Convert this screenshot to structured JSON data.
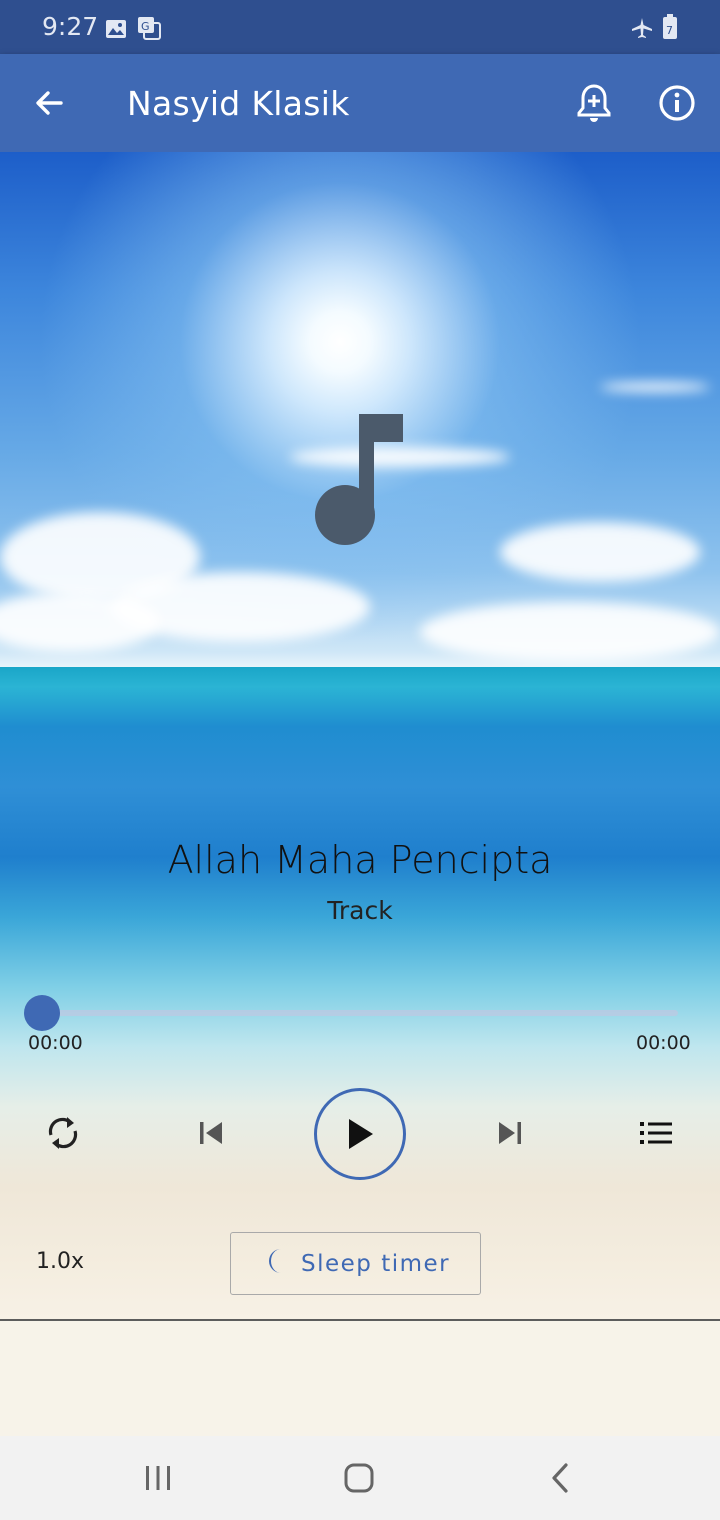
{
  "status_bar": {
    "time": "9:27",
    "left_icons": [
      "gallery-icon",
      "translate-icon"
    ],
    "right_icons": [
      "airplane-icon",
      "battery-icon"
    ],
    "battery_label": "7"
  },
  "app_bar": {
    "title": "Nasyid Klasik",
    "back_icon": "arrow-left-icon",
    "actions": [
      "bell-plus-icon",
      "info-icon"
    ]
  },
  "player": {
    "artwork_icon": "music-note-icon",
    "track_title": "Allah Maha Pencipta",
    "track_subtitle": "Track",
    "position": "00:00",
    "duration": "00:00",
    "progress": 0,
    "controls": [
      "repeat-icon",
      "skip-previous-icon",
      "play-icon",
      "skip-next-icon",
      "playlist-icon"
    ],
    "speed": "1.0x",
    "sleep_timer_label": "Sleep timer"
  },
  "nav_bar": {
    "buttons": [
      "recents-icon",
      "home-icon",
      "back-icon"
    ]
  },
  "colors": {
    "accent": "#3f69b4",
    "status_bar": "#2f4f8f"
  }
}
